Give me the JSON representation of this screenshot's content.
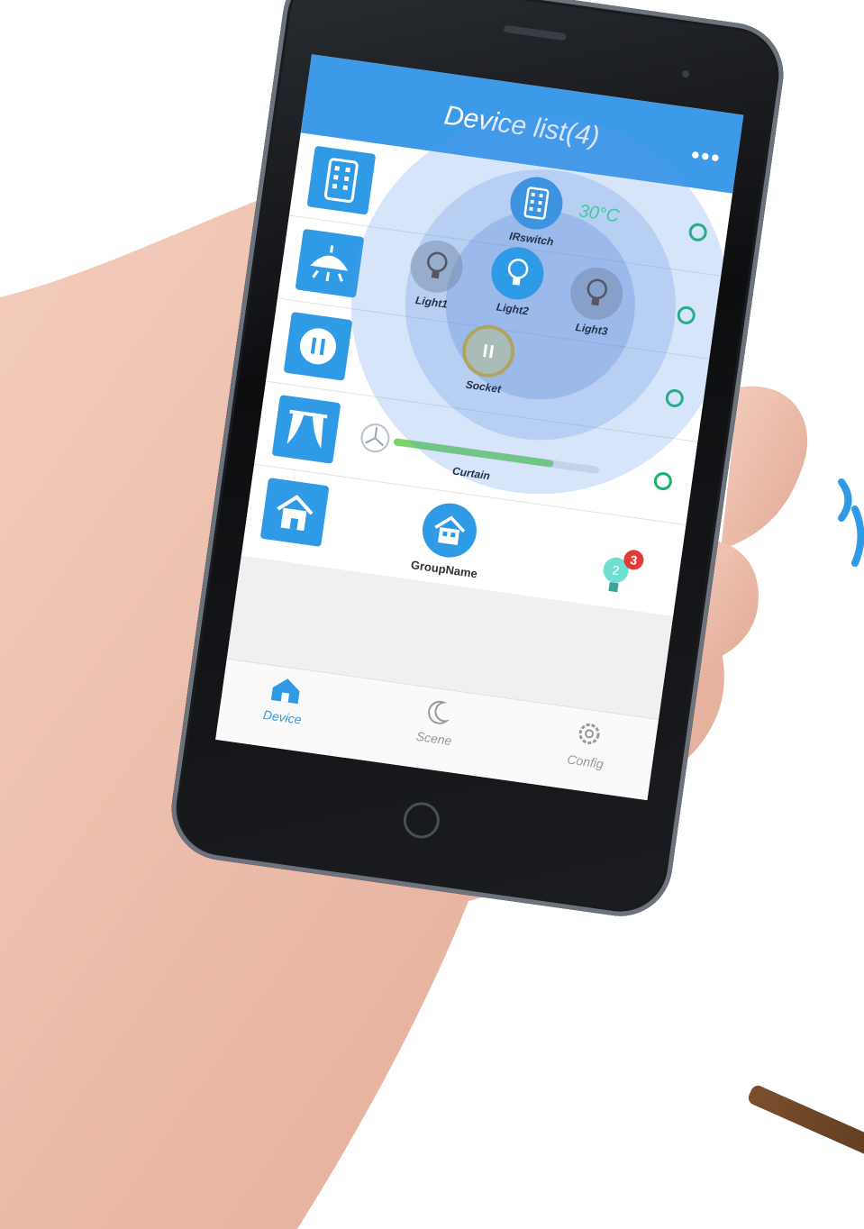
{
  "header": {
    "title": "Device list(4)",
    "more": "•••"
  },
  "overlay": {
    "temperature": "30°C",
    "irswitch_label": "IRswitch",
    "light1_label": "Light1",
    "light2_label": "Light2",
    "light3_label": "Light3",
    "socket_label": "Socket"
  },
  "rows": {
    "curtain_label": "Curtain",
    "curtain_progress": 0.78
  },
  "group": {
    "label": "GroupName",
    "badge_count": "3",
    "bulb_number": "2"
  },
  "tabs": [
    {
      "label": "Device",
      "icon": "home-icon",
      "active": true
    },
    {
      "label": "Scene",
      "icon": "moon-icon",
      "active": false
    },
    {
      "label": "Config",
      "icon": "gear-icon",
      "active": false
    }
  ],
  "colors": {
    "accent": "#2f9ae6",
    "header": "#3d9ae8",
    "status_ring": "#19b36a",
    "badge": "#e53935",
    "temperature": "#43c7a6"
  }
}
